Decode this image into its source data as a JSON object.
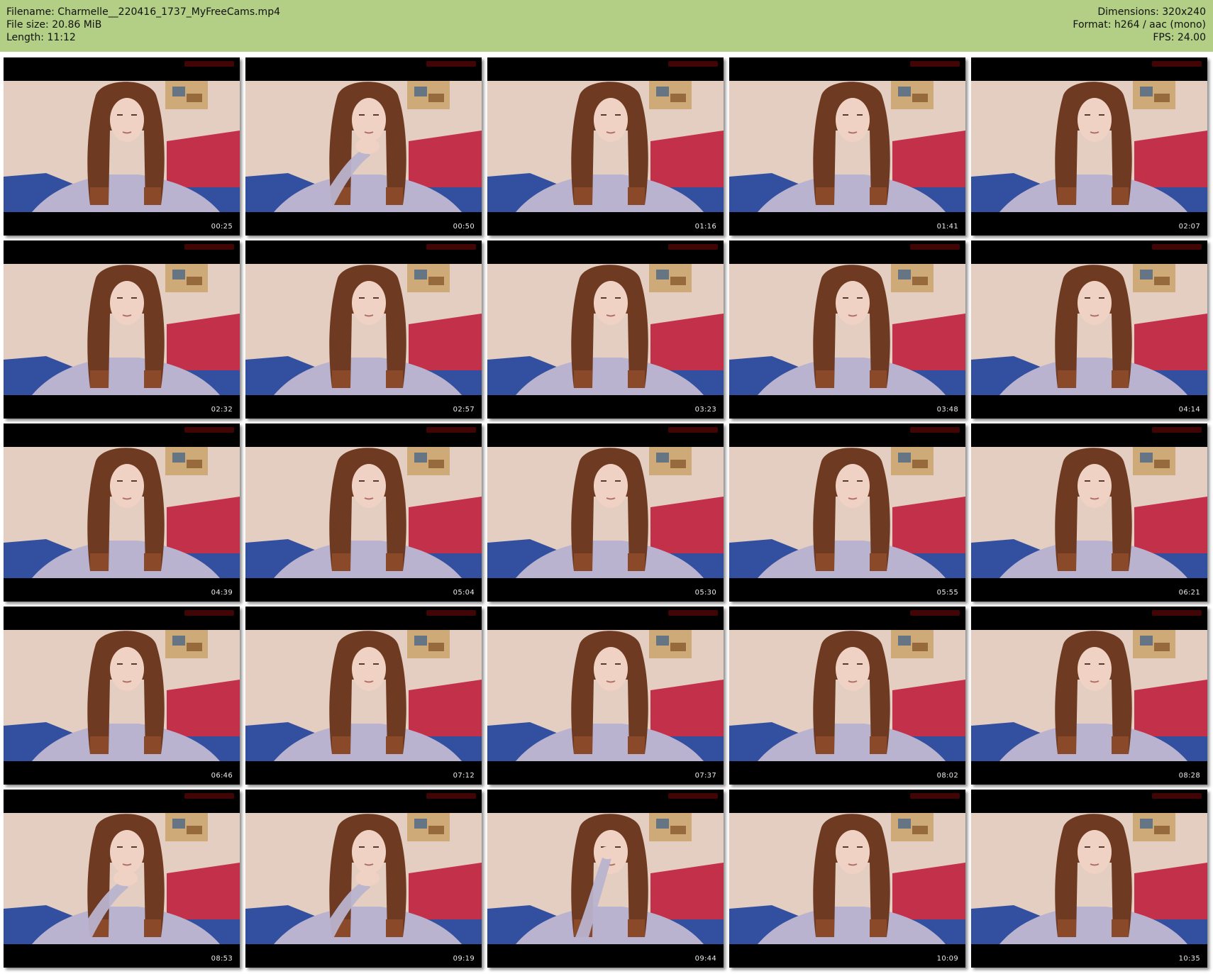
{
  "header": {
    "background": "#b2cf85",
    "filename": "Filename: Charmelle__220416_1737_MyFreeCams.mp4",
    "filesize": "File size: 20.86 MiB",
    "length": "Length: 11:12",
    "dimensions": "Dimensions: 320x240",
    "format": "Format: h264 / aac (mono)",
    "fps": "FPS: 24.00"
  },
  "thumbnails": [
    {
      "time": "00:25"
    },
    {
      "time": "00:50"
    },
    {
      "time": "01:16"
    },
    {
      "time": "01:41"
    },
    {
      "time": "02:07"
    },
    {
      "time": "02:32"
    },
    {
      "time": "02:57"
    },
    {
      "time": "03:23"
    },
    {
      "time": "03:48"
    },
    {
      "time": "04:14"
    },
    {
      "time": "04:39"
    },
    {
      "time": "05:04"
    },
    {
      "time": "05:30"
    },
    {
      "time": "05:55"
    },
    {
      "time": "06:21"
    },
    {
      "time": "06:46"
    },
    {
      "time": "07:12"
    },
    {
      "time": "07:37"
    },
    {
      "time": "08:02"
    },
    {
      "time": "08:28"
    },
    {
      "time": "08:53"
    },
    {
      "time": "09:19"
    },
    {
      "time": "09:44"
    },
    {
      "time": "10:09"
    },
    {
      "time": "10:35"
    }
  ],
  "colors": {
    "frame": "#000000",
    "wall": "#e4cdc1",
    "hair": "#6e3a22",
    "hair_tips": "#8a4a2a",
    "skin": "#efd2c4",
    "sweater": "#b9b3cf",
    "pillow": "#c2304a",
    "bedding": "#3350a0",
    "poster": "#c9a36a",
    "timestamp": "#e9e9e9"
  }
}
